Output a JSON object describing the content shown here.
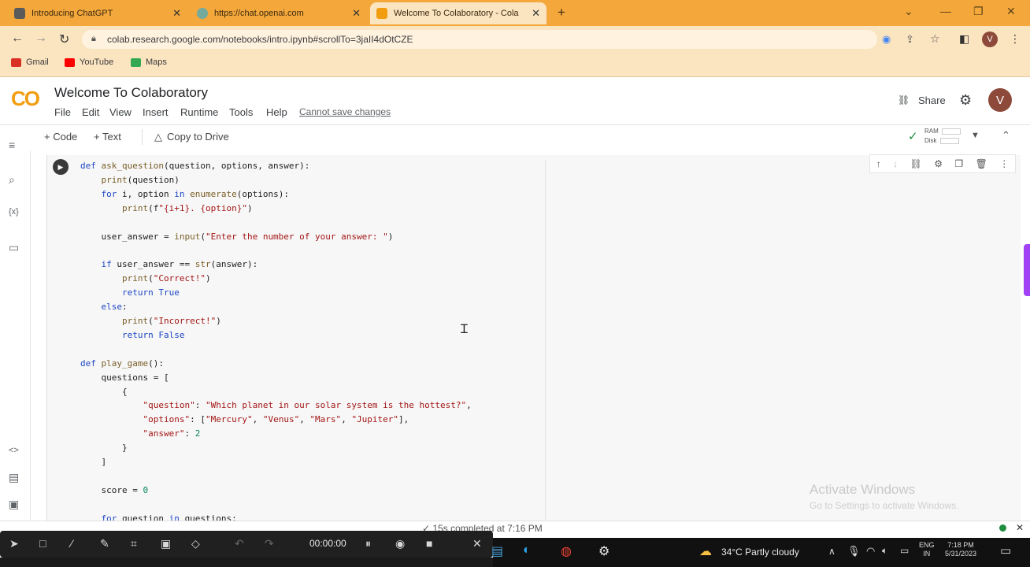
{
  "browser": {
    "tabs": [
      {
        "title": "Introducing ChatGPT",
        "color": "#5a5a5a"
      },
      {
        "title": "https://chat.openai.com",
        "color": "#74aa9c"
      },
      {
        "title": "Welcome To Colaboratory - Cola",
        "color": "#f29d0f",
        "active": true
      }
    ],
    "new_tab": "+",
    "url": "colab.research.google.com/notebooks/intro.ipynb#scrollTo=3jaII4dOtCZE",
    "profile_initial": "V",
    "bookmarks": [
      {
        "label": "Gmail",
        "color": "#d93025"
      },
      {
        "label": "YouTube",
        "color": "#ff0000"
      },
      {
        "label": "Maps",
        "color": "#34a853"
      }
    ]
  },
  "colab": {
    "logo": "CO",
    "title": "Welcome To Colaboratory",
    "menu": [
      "File",
      "Edit",
      "View",
      "Insert",
      "Runtime",
      "Tools",
      "Help"
    ],
    "cannot_save": "Cannot save changes",
    "share": "Share",
    "avatar": "V",
    "toolbar": {
      "code": "+ Code",
      "text": "+ Text",
      "copy_drive": "Copy to Drive",
      "ram": "RAM",
      "disk": "Disk"
    },
    "rail_icons": [
      "menu-icon",
      "search-icon",
      "variables-icon",
      "folder-icon",
      "code-snippets-icon",
      "command-palette-icon",
      "terminal-icon"
    ],
    "rail_glyphs": {
      "menu": "≡",
      "search": "⌕",
      "variables": "{x}",
      "folder": "▭",
      "snippets": "<>",
      "palette": "▤",
      "terminal": "▣"
    }
  },
  "code_lines": [
    "def ask_question(question, options, answer):",
    "    print(question)",
    "    for i, option in enumerate(options):",
    "        print(f\"{i+1}. {option}\")",
    "",
    "    user_answer = input(\"Enter the number of your answer: \")",
    "",
    "    if user_answer == str(answer):",
    "        print(\"Correct!\")",
    "        return True",
    "    else:",
    "        print(\"Incorrect!\")",
    "        return False",
    "",
    "def play_game():",
    "    questions = [",
    "        {",
    "            \"question\": \"Which planet in our solar system is the hottest?\",",
    "            \"options\": [\"Mercury\", \"Venus\", \"Mars\", \"Jupiter\"],",
    "            \"answer\": 2",
    "        }",
    "    ]",
    "",
    "    score = 0",
    "",
    "    for question in questions:"
  ],
  "watermark": {
    "line1": "Activate Windows",
    "line2": "Go to Settings to activate Windows."
  },
  "status": {
    "text": "✓ 15s   completed at 7:16 PM"
  },
  "recorder": {
    "timer": "00:00:00"
  },
  "taskbar": {
    "weather": "34°C  Partly cloudy",
    "lang_line1": "ENG",
    "lang_line2": "IN",
    "time": "7:18 PM",
    "date": "5/31/2023"
  }
}
